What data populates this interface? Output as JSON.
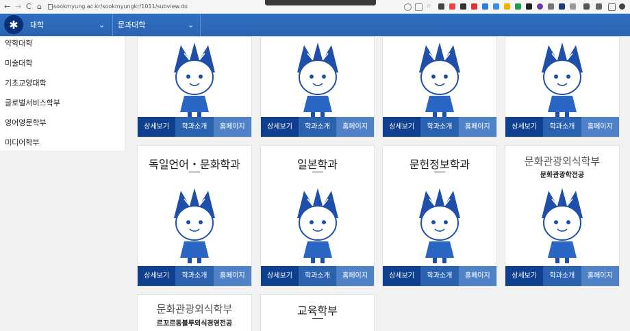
{
  "browser": {
    "url": "sookmyung.ac.kr/sookmyungkr/1011/subview.do",
    "nav_back": "←",
    "nav_forward": "→",
    "nav_reload": "C",
    "nav_home": "⌂"
  },
  "header": {
    "logo_glyph": "✱",
    "dropdown1": "대학",
    "dropdown2": "문과대학",
    "chevron": "⌄"
  },
  "sidebar": {
    "items": [
      {
        "label": "약학대학"
      },
      {
        "label": "미술대학"
      },
      {
        "label": "기초교양대학"
      },
      {
        "label": "글로벌서비스학부"
      },
      {
        "label": "영어영문학부"
      },
      {
        "label": "미디어학부"
      }
    ]
  },
  "buttons": {
    "detail": "상세보기",
    "intro": "학과소개",
    "homepage": "홈페이지"
  },
  "cards": [
    {
      "title": "",
      "subtitle": ""
    },
    {
      "title": "",
      "subtitle": ""
    },
    {
      "title": "",
      "subtitle": ""
    },
    {
      "title": "",
      "subtitle": ""
    },
    {
      "title": "독일언어・문화학과",
      "subtitle": ""
    },
    {
      "title": "일본학과",
      "subtitle": ""
    },
    {
      "title": "문헌정보학과",
      "subtitle": ""
    },
    {
      "title": "문화관광외식학부",
      "subtitle": "문화관광학전공"
    },
    {
      "title": "문화관광외식학부",
      "subtitle": "르꼬르동블루외식경영전공"
    },
    {
      "title": "교육학부",
      "subtitle": ""
    }
  ],
  "colors": {
    "header_blue": "#2f6fc0",
    "btn_dark": "#0f3f8f",
    "btn_mid": "#2b62b0",
    "btn_light": "#4f82c7",
    "mascot_blue": "#1f4fa8"
  }
}
